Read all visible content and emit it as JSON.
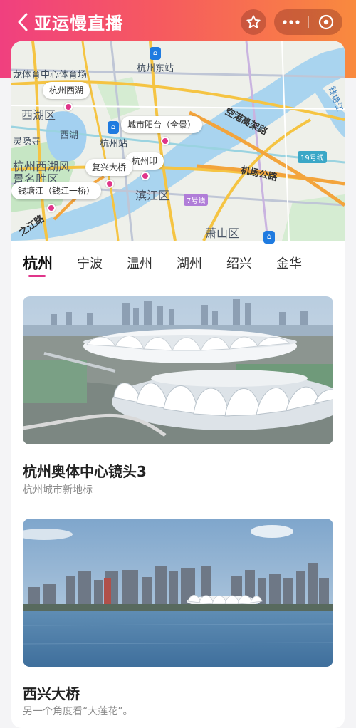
{
  "nav": {
    "title": "亚运慢直播"
  },
  "map": {
    "districts": [
      "西湖区",
      "滨江区",
      "萧山区",
      "西湖"
    ],
    "roads": [
      "空港高架路",
      "机场公路",
      "之江路"
    ],
    "line_tags": [
      "19号线",
      "7号线"
    ],
    "stations": [
      "杭州东站",
      "杭州站"
    ],
    "edge_labels": [
      "龙体育中心体育场",
      "灵隐寺",
      "杭州西湖风",
      "景名胜区",
      "钱塘江"
    ],
    "pins": [
      {
        "label": "杭州西湖"
      },
      {
        "label": "城市阳台（全景）"
      },
      {
        "label": "杭州印"
      },
      {
        "label": "复兴大桥"
      },
      {
        "label": "钱塘江（钱江一桥）"
      }
    ],
    "colors": {
      "river": "#a9d4ef",
      "water": "#a3d0f0",
      "green": "#c6e6c4",
      "road_yellow": "#f5c443",
      "road_orange": "#f3a43c",
      "metro": "#bfc6d6"
    }
  },
  "tabs": {
    "items": [
      "杭州",
      "宁波",
      "温州",
      "湖州",
      "绍兴",
      "金华"
    ],
    "active": "杭州"
  },
  "items": [
    {
      "title": "杭州奥体中心镜头3",
      "subtitle": "杭州城市新地标",
      "image": "stadium-aerial-photo"
    },
    {
      "title": "西兴大桥",
      "subtitle": "另一个角度看“大莲花”。",
      "image": "skyline-across-river-photo"
    }
  ],
  "accent": "#e0358a"
}
